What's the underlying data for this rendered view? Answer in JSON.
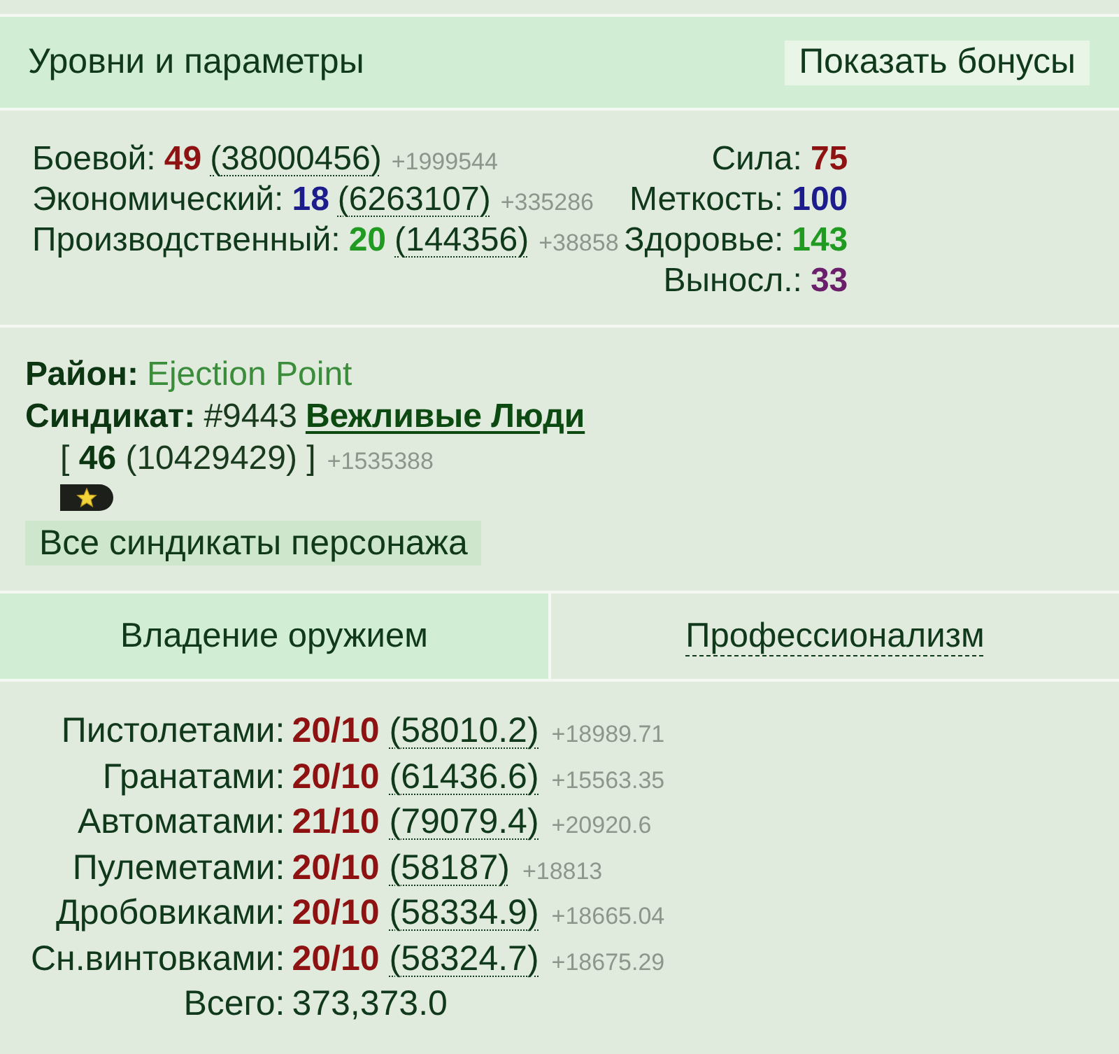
{
  "header": {
    "title": "Уровни и параметры",
    "bonus_button": "Показать бонусы"
  },
  "levels": [
    {
      "label": "Боевой:",
      "value": "49",
      "color": "#8e1212",
      "experience": "(38000456)",
      "gain": "+1999544"
    },
    {
      "label": "Экономический:",
      "value": "18",
      "color": "#1c1c8c",
      "experience": "(6263107)",
      "gain": "+335286"
    },
    {
      "label": "Производственный:",
      "value": "20",
      "color": "#219a21",
      "experience": "(144356)",
      "gain": "+38858"
    }
  ],
  "stats": [
    {
      "label": "Сила:",
      "value": "75",
      "color": "#8e1212"
    },
    {
      "label": "Меткость:",
      "value": "100",
      "color": "#1c1c8c"
    },
    {
      "label": "Здоровье:",
      "value": "143",
      "color": "#219a21"
    },
    {
      "label": "Выносл.:",
      "value": "33",
      "color": "#6b1f6b"
    }
  ],
  "district": {
    "label": "Район:",
    "value": "Ejection Point"
  },
  "syndicate": {
    "label": "Синдикат:",
    "number": "#9443",
    "name": "Вежливые Люди",
    "rank_line": "[ **46** (10429429) ]",
    "gain": "+1535388",
    "all_button": "Все синдикаты персонажа"
  },
  "tabs": [
    {
      "label": "Владение оружием",
      "selected": true
    },
    {
      "label": "Профессионализм",
      "selected": false
    }
  ],
  "weapons": [
    {
      "label": "Пистолетами:",
      "value": "20/10",
      "experience": "(58010.2)",
      "gain": "+18989.71"
    },
    {
      "label": "Гранатами:",
      "value": "20/10",
      "experience": "(61436.6)",
      "gain": "+15563.35"
    },
    {
      "label": "Автоматами:",
      "value": "21/10",
      "experience": "(79079.4)",
      "gain": "+20920.6"
    },
    {
      "label": "Пулеметами:",
      "value": "20/10",
      "experience": "(58187)",
      "gain": "+18813"
    },
    {
      "label": "Дробовиками:",
      "value": "20/10",
      "experience": "(58334.9)",
      "gain": "+18665.04"
    },
    {
      "label": "Сн.винтовками:",
      "value": "20/10",
      "experience": "(58324.7)",
      "gain": "+18675.29"
    }
  ],
  "total": {
    "label": "Всего:",
    "value": "373,373.0"
  }
}
